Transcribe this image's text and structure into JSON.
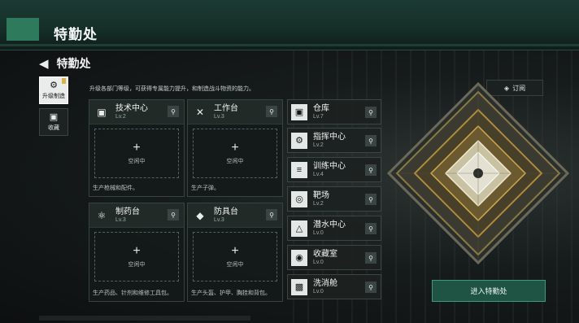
{
  "header": {
    "title": "特勤处"
  },
  "page": {
    "back_icon": "chevron-left-icon",
    "title": "特勤处",
    "description": "升级各部门等级，可获得专属能力提升，和制造战斗物资的能力。"
  },
  "sidebar": {
    "items": [
      {
        "label": "升级制造",
        "icon": "build-icon",
        "active": true
      },
      {
        "label": "收藏",
        "icon": "collection-icon",
        "active": false
      }
    ]
  },
  "subscribe": {
    "label": "订阅",
    "icon": "bell-icon"
  },
  "workshops": [
    {
      "name": "技术中心",
      "level": "Lv.2",
      "icon": "monitor-icon",
      "slot_label": "空闲中",
      "produce": "生产枪械和配件。"
    },
    {
      "name": "工作台",
      "level": "Lv.3",
      "icon": "tools-icon",
      "slot_label": "空闲中",
      "produce": "生产子弹。"
    },
    {
      "name": "制药台",
      "level": "Lv.3",
      "icon": "medicine-icon",
      "slot_label": "空闲中",
      "produce": "生产药品、针剂和维修工具包。"
    },
    {
      "name": "防具台",
      "level": "Lv.3",
      "icon": "armor-icon",
      "slot_label": "空闲中",
      "produce": "生产头盔、护甲、胸挂和背包。"
    }
  ],
  "facilities": [
    {
      "name": "仓库",
      "level": "Lv.7",
      "icon": "warehouse-icon"
    },
    {
      "name": "指挥中心",
      "level": "Lv.2",
      "icon": "command-icon"
    },
    {
      "name": "训练中心",
      "level": "Lv.4",
      "icon": "dumbbell-icon"
    },
    {
      "name": "靶场",
      "level": "Lv.2",
      "icon": "target-icon"
    },
    {
      "name": "潜水中心",
      "level": "Lv.0",
      "icon": "diving-icon"
    },
    {
      "name": "收藏室",
      "level": "Lv.0",
      "icon": "collection-room-icon"
    },
    {
      "name": "洗消舱",
      "level": "Lv.0",
      "icon": "decon-icon"
    }
  ],
  "enter_button": {
    "label": "进入特勤处"
  },
  "colors": {
    "accent": "#2e7a5c",
    "button": "#1f5444",
    "button_border": "#3b9a78"
  }
}
